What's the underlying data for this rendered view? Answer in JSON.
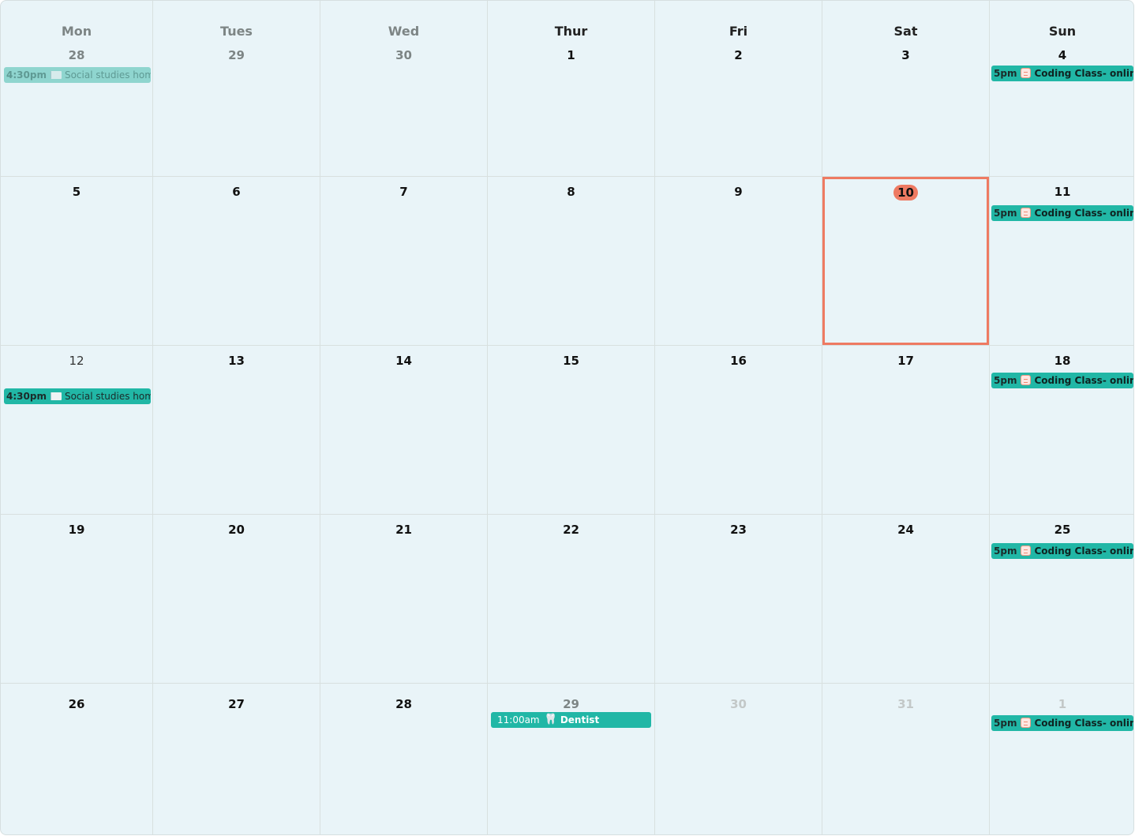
{
  "weekdays": [
    "Mon",
    "Tues",
    "Wed",
    "Thur",
    "Fri",
    "Sat",
    "Sun"
  ],
  "weeks": [
    [
      "28",
      "29",
      "30",
      "1",
      "2",
      "3",
      "4"
    ],
    [
      "5",
      "6",
      "7",
      "8",
      "9",
      "10",
      "11"
    ],
    [
      "12",
      "13",
      "14",
      "15",
      "16",
      "17",
      "18"
    ],
    [
      "19",
      "20",
      "21",
      "22",
      "23",
      "24",
      "25"
    ],
    [
      "26",
      "27",
      "28",
      "29",
      "30",
      "31",
      "1"
    ]
  ],
  "today": "10",
  "colors": {
    "today_accent": "#ee7a62",
    "event": "#21b7a6",
    "event_past": "#8fd5cf",
    "background": "#e9f4f8"
  },
  "events": [
    {
      "week": 0,
      "day": 0,
      "time": "4:30pm",
      "title": "Social studies home",
      "icon": "book-icon",
      "kind": "social",
      "state": "past"
    },
    {
      "week": 2,
      "day": 0,
      "time": "4:30pm",
      "title": "Social studies homev",
      "icon": "book-icon",
      "kind": "social",
      "state": "normal"
    },
    {
      "week": 0,
      "day": 6,
      "time": "5pm",
      "title": "Coding Class- online",
      "icon": "planner-icon",
      "kind": "coding",
      "state": "normal"
    },
    {
      "week": 1,
      "day": 6,
      "time": "5pm",
      "title": "Coding Class- online",
      "icon": "planner-icon",
      "kind": "coding",
      "state": "normal"
    },
    {
      "week": 2,
      "day": 6,
      "time": "5pm",
      "title": "Coding Class- online",
      "icon": "planner-icon",
      "kind": "coding",
      "state": "normal"
    },
    {
      "week": 3,
      "day": 6,
      "time": "5pm",
      "title": "Coding Class- online",
      "icon": "planner-icon",
      "kind": "coding",
      "state": "normal"
    },
    {
      "week": 4,
      "day": 6,
      "time": "5pm",
      "title": "Coding Class- online",
      "icon": "planner-icon",
      "kind": "coding",
      "state": "normal"
    },
    {
      "week": 4,
      "day": 3,
      "time": "11:00am",
      "title": "Dentist",
      "icon": "tooth-icon",
      "kind": "dentist",
      "state": "normal"
    }
  ]
}
